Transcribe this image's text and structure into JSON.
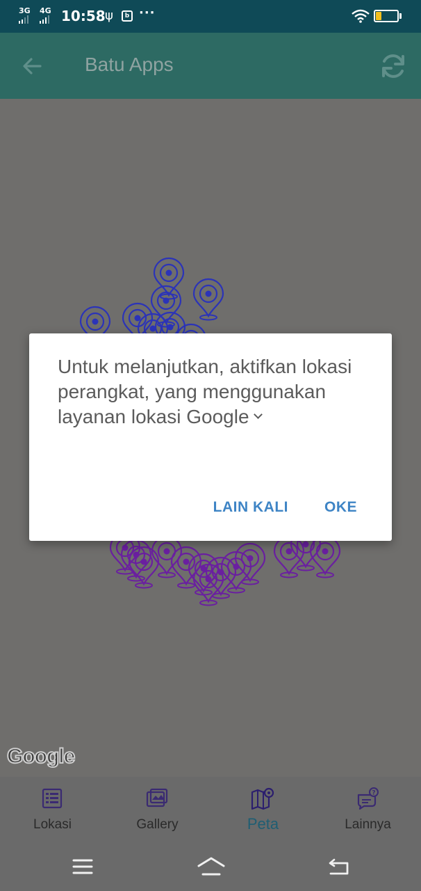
{
  "status_bar": {
    "net1": "3G",
    "net2": "4G",
    "time": "10:58",
    "notif": "b",
    "battery": "27",
    "battery_level": 0.27,
    "battery_color": "#f3c01e"
  },
  "app_bar": {
    "title": "Batu Apps",
    "back_icon": "arrow-left-icon",
    "refresh_icon": "refresh-icon",
    "color": "#2d6a63"
  },
  "map": {
    "attribution": "Google",
    "marker_color_top": "#2b33b8",
    "marker_color_bottom": "#6a1fa0"
  },
  "dialog": {
    "message": "Untuk melanjutkan, aktifkan lokasi perangkat, yang menggunakan layanan lokasi",
    "link": "Google",
    "negative": "LAIN KALI",
    "positive": "OKE",
    "accent": "#3e84c5"
  },
  "bottom_nav": {
    "items": [
      {
        "label": "Lokasi",
        "icon": "list-icon",
        "active": false
      },
      {
        "label": "Gallery",
        "icon": "gallery-icon",
        "active": false
      },
      {
        "label": "Peta",
        "icon": "map-icon",
        "active": true
      },
      {
        "label": "Lainnya",
        "icon": "chat-question-icon",
        "active": false
      }
    ]
  },
  "system_nav": {
    "menu": "menu-icon",
    "home": "home-icon",
    "back": "back-icon"
  }
}
